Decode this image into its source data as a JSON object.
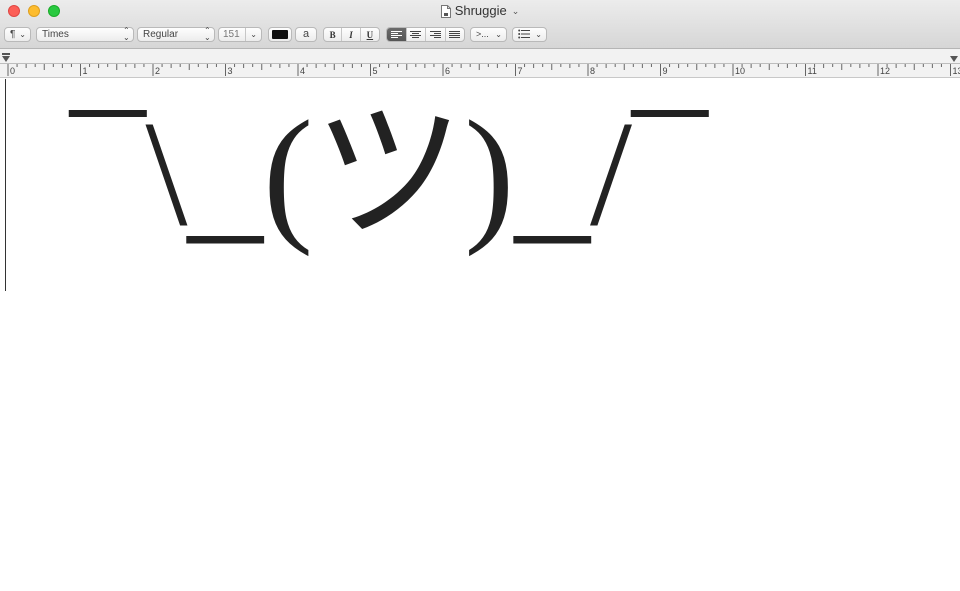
{
  "window": {
    "title": "Shruggie",
    "traffic_lights": {
      "close": "#fc5f57",
      "minimize": "#fdbc2e",
      "zoom": "#29c940"
    }
  },
  "toolbar": {
    "paragraph_styles_label": "¶",
    "font_family": "Times",
    "font_style": "Regular",
    "font_size": "151",
    "text_color": "#111111",
    "highlight_label": "a",
    "bold_label": "B",
    "italic_label": "I",
    "underline_label": "U",
    "alignment_selected": "left",
    "spacing_label": ">...",
    "list_label": "list-icon"
  },
  "ruler": {
    "numbers": [
      "0",
      "1",
      "2",
      "3",
      "4",
      "5",
      "6",
      "7",
      "8",
      "9",
      "10",
      "11",
      "12",
      "13"
    ]
  },
  "document": {
    "text": "¯\\_(ツ)_/¯"
  }
}
